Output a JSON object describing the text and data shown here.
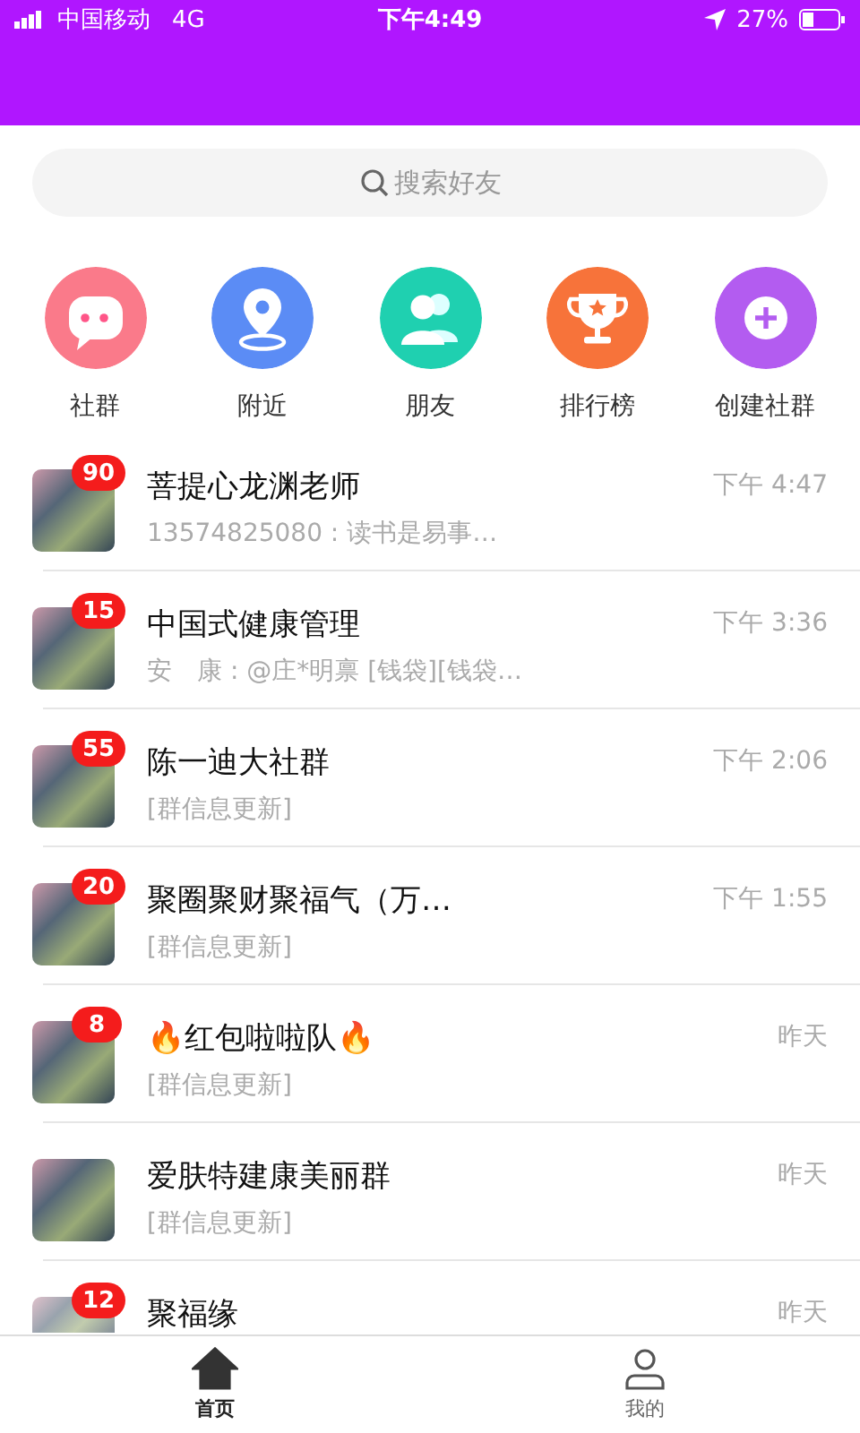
{
  "status_bar": {
    "carrier": "中国移动",
    "network": "4G",
    "time": "下午4:49",
    "battery": "27%"
  },
  "search": {
    "placeholder": "搜索好友"
  },
  "shortcuts": [
    {
      "label": "社群",
      "kind": "chat",
      "color": "#fa7a8a"
    },
    {
      "label": "附近",
      "kind": "location",
      "color": "#5b8cf5"
    },
    {
      "label": "朋友",
      "kind": "friends",
      "color": "#1fd0b0"
    },
    {
      "label": "排行榜",
      "kind": "trophy",
      "color": "#f7733a"
    },
    {
      "label": "创建社群",
      "kind": "create",
      "color": "#b35cf0"
    }
  ],
  "chats": [
    {
      "name": "菩提心龙渊老师",
      "preview": "13574825080 : 读书是易事…",
      "time": "下午 4:47",
      "badge": "90"
    },
    {
      "name": "中国式健康管理",
      "preview": "安　康 : @庄*明禀 [钱袋][钱袋…",
      "time": "下午 3:36",
      "badge": "15"
    },
    {
      "name": "陈一迪大社群",
      "preview": "[群信息更新]",
      "time": "下午 2:06",
      "badge": "55"
    },
    {
      "name": "聚圈聚财聚福气（万…",
      "preview": "[群信息更新]",
      "time": "下午 1:55",
      "badge": "20"
    },
    {
      "name": "🔥红包啦啦队🔥",
      "preview": "[群信息更新]",
      "time": "昨天",
      "badge": "8"
    },
    {
      "name": "爱肤特建康美丽群",
      "preview": "[群信息更新]",
      "time": "昨天"
    },
    {
      "name": "聚福缘",
      "time": "昨天",
      "badge": "12"
    }
  ],
  "tab_bar": [
    {
      "label": "首页",
      "kind": "home",
      "selected": true
    },
    {
      "label": "我的",
      "kind": "profile",
      "selected": false
    }
  ]
}
